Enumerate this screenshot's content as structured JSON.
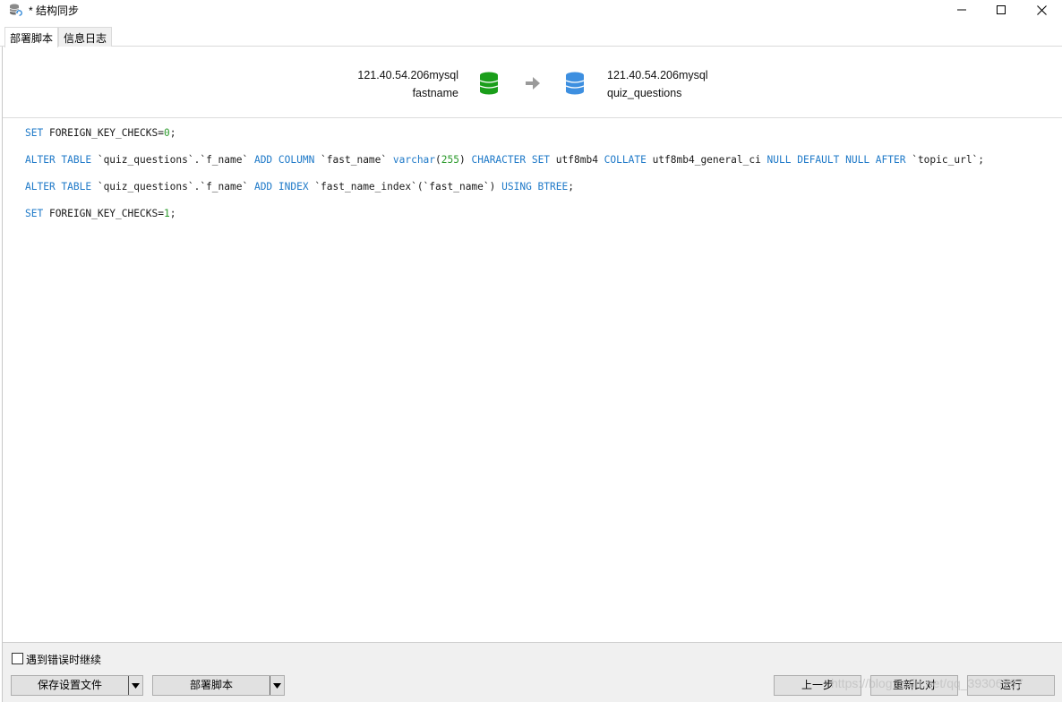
{
  "window": {
    "title": "* 结构同步",
    "icon": "db-sync-icon"
  },
  "tabs": [
    {
      "label": "部署脚本",
      "active": true
    },
    {
      "label": "信息日志",
      "active": false
    }
  ],
  "source": {
    "connection": "121.40.54.206mysql",
    "database": "fastname",
    "icon": "database-green-icon",
    "color": "#1a9e1a"
  },
  "target": {
    "connection": "121.40.54.206mysql",
    "database": "quiz_questions",
    "icon": "database-blue-icon",
    "color": "#3d8fe0"
  },
  "script_lines": [
    [
      [
        "kw",
        "SET"
      ],
      [
        "t",
        " FOREIGN_KEY_CHECKS="
      ],
      [
        "num",
        "0"
      ],
      [
        "t",
        ";"
      ]
    ],
    [
      [
        "kw",
        "ALTER TABLE"
      ],
      [
        "t",
        " `quiz_questions`.`f_name` "
      ],
      [
        "kw",
        "ADD COLUMN"
      ],
      [
        "t",
        " `fast_name` "
      ],
      [
        "kw",
        "varchar"
      ],
      [
        "t",
        "("
      ],
      [
        "num",
        "255"
      ],
      [
        "t",
        ") "
      ],
      [
        "kw",
        "CHARACTER SET"
      ],
      [
        "t",
        " utf8mb4 "
      ],
      [
        "kw",
        "COLLATE"
      ],
      [
        "t",
        " utf8mb4_general_ci "
      ],
      [
        "kw",
        "NULL DEFAULT NULL AFTER"
      ],
      [
        "t",
        " `topic_url`;"
      ]
    ],
    [
      [
        "kw",
        "ALTER TABLE"
      ],
      [
        "t",
        " `quiz_questions`.`f_name` "
      ],
      [
        "kw",
        "ADD INDEX"
      ],
      [
        "t",
        " `fast_name_index`(`fast_name`) "
      ],
      [
        "kw",
        "USING BTREE"
      ],
      [
        "t",
        ";"
      ]
    ],
    [
      [
        "kw",
        "SET"
      ],
      [
        "t",
        " FOREIGN_KEY_CHECKS="
      ],
      [
        "num",
        "1"
      ],
      [
        "t",
        ";"
      ]
    ]
  ],
  "colors": {
    "keyword": "#1e79c8",
    "number": "#2b9a2b"
  },
  "bottom": {
    "continue_on_error_label": "遇到错误时继续",
    "continue_on_error_checked": false,
    "save_profile_label": "保存设置文件",
    "deploy_script_label": "部署脚本",
    "back_label": "上一步",
    "recompare_label": "重新比对",
    "run_label": "运行"
  },
  "watermark": "https://blog.csdn.net/qq_39306797"
}
